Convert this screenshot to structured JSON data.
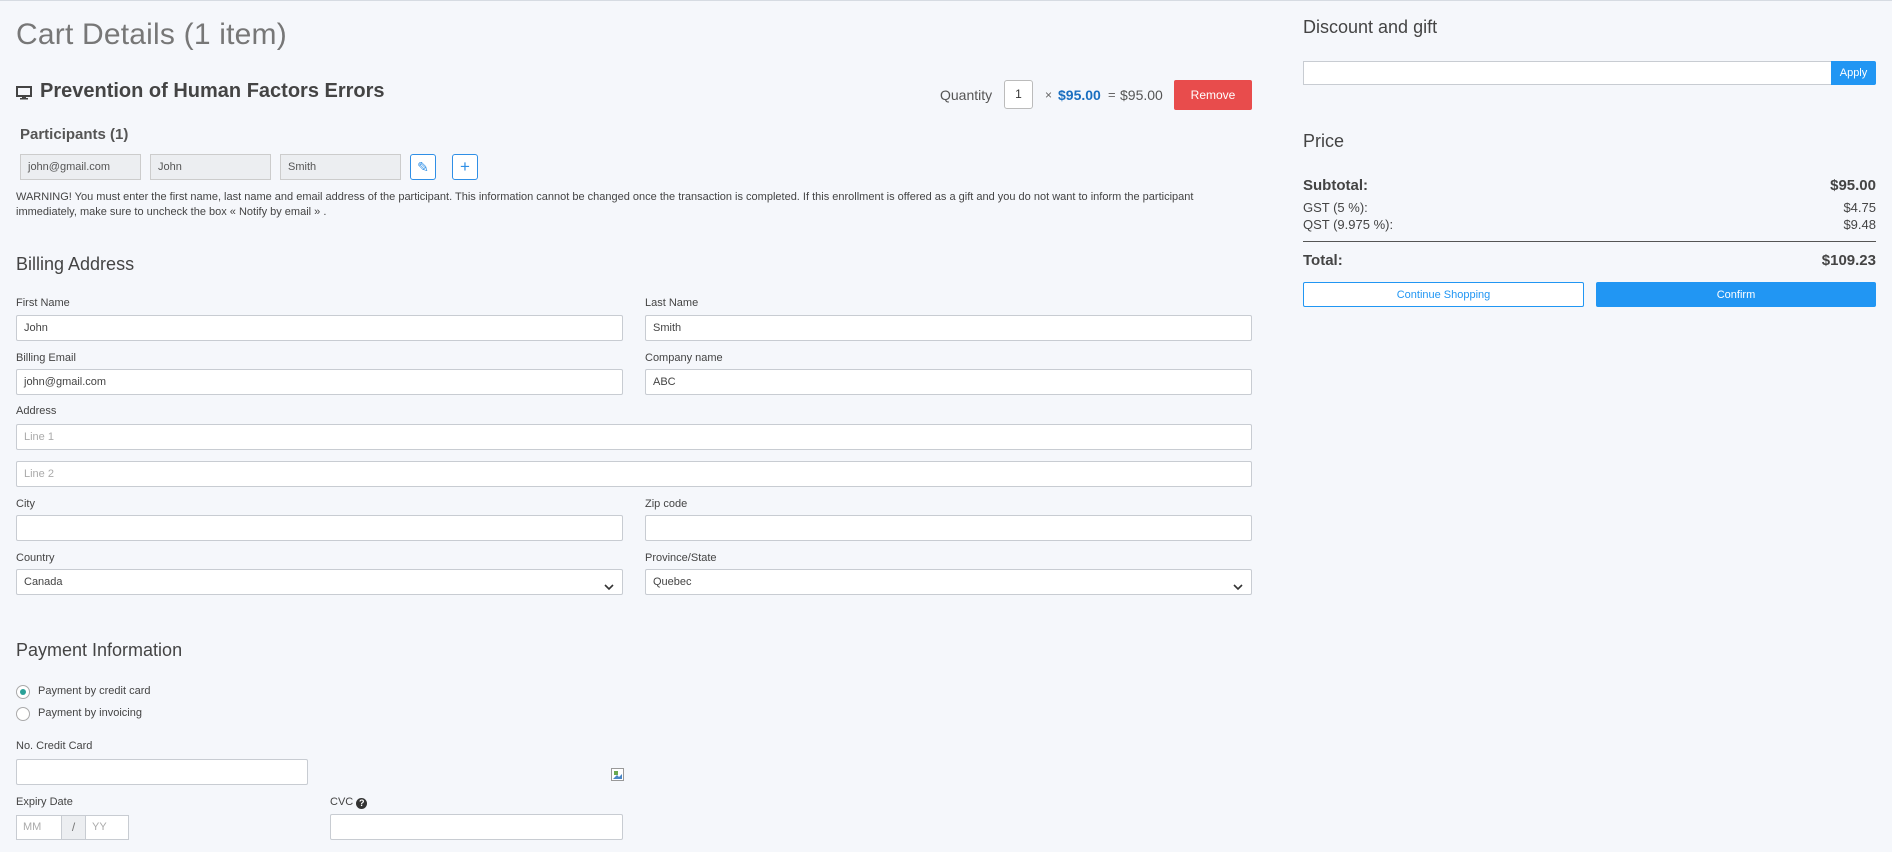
{
  "cart": {
    "title": "Cart Details (1 item)",
    "course_title": "Prevention of Human Factors Errors",
    "course_icon": "monitor-icon",
    "quantity_label": "Quantity",
    "quantity": "1",
    "times": "×",
    "unit_price": "$95.00",
    "equals": "=",
    "line_total": "$95.00",
    "remove_label": "Remove"
  },
  "participants": {
    "title": "Participants (1)",
    "email": "john@gmail.com",
    "first_name": "John",
    "last_name": "Smith",
    "edit_icon": "pencil-icon",
    "add_icon": "plus-icon",
    "edit_glyph": "✎",
    "add_glyph": "+",
    "warning": "WARNING! You must enter the first name, last name and email address of the participant. This information cannot be changed once the transaction is completed. If this enrollment is offered as a gift and you do not want to inform the participant immediately, make sure to uncheck the box « Notify by email » ."
  },
  "billing": {
    "title": "Billing Address",
    "first_name_label": "First Name",
    "first_name": "John",
    "last_name_label": "Last Name",
    "last_name": "Smith",
    "email_label": "Billing Email",
    "email": "john@gmail.com",
    "company_label": "Company name",
    "company": "ABC",
    "address_label": "Address",
    "line1_placeholder": "Line 1",
    "line2_placeholder": "Line 2",
    "city_label": "City",
    "city": "",
    "zip_label": "Zip code",
    "zip": "",
    "country_label": "Country",
    "country": "Canada",
    "province_label": "Province/State",
    "province": "Quebec"
  },
  "payment": {
    "title": "Payment Information",
    "option_credit": "Payment by credit card",
    "option_invoice": "Payment by invoicing",
    "selected": "credit",
    "card_label": "No. Credit Card",
    "expiry_label": "Expiry Date",
    "mm_placeholder": "MM",
    "expiry_sep": "/",
    "yy_placeholder": "YY",
    "cvc_label": "CVC",
    "help_glyph": "?"
  },
  "discount": {
    "title": "Discount and gift",
    "apply_label": "Apply"
  },
  "price": {
    "title": "Price",
    "subtotal_label": "Subtotal:",
    "subtotal": "$95.00",
    "gst_label": "GST (5 %):",
    "gst": "$4.75",
    "qst_label": "QST (9.975 %):",
    "qst": "$9.48",
    "total_label": "Total:",
    "total": "$109.23",
    "continue_label": "Continue Shopping",
    "confirm_label": "Confirm"
  },
  "colors": {
    "accent": "#2196f3",
    "danger": "#e84c4c",
    "price_blue": "#1a6fc0",
    "radio_green": "#2aa198"
  }
}
